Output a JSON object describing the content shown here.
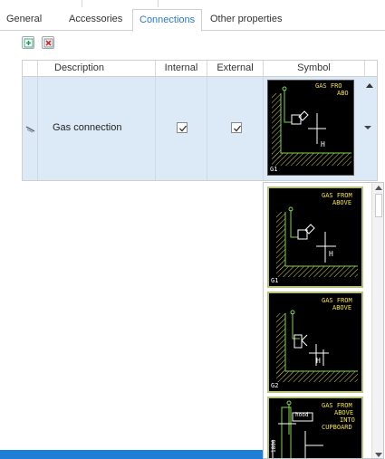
{
  "tabs": [
    {
      "label": "General",
      "active": false
    },
    {
      "label": "Accessories",
      "active": false
    },
    {
      "label": "Connections",
      "active": true
    },
    {
      "label": "Other properties",
      "active": false
    }
  ],
  "toolbar": {
    "add_icon": "add-row-icon",
    "remove_icon": "delete-row-icon"
  },
  "grid": {
    "columns": [
      "Description",
      "Internal",
      "External",
      "Symbol"
    ],
    "rows": [
      {
        "description": "Gas connection",
        "internal": true,
        "external": true,
        "symbol": "G1",
        "symbol_text": [
          "GAS FRO",
          "ABO"
        ],
        "symbol_h": "H"
      }
    ]
  },
  "symbol_options": [
    {
      "code": "G1",
      "lines": [
        "GAS FROM",
        "ABOVE"
      ],
      "h": "H"
    },
    {
      "code": "G2",
      "lines": [
        "GAS FROM",
        "ABOVE"
      ],
      "h": "H"
    },
    {
      "code": "",
      "lines": [
        "GAS FROM",
        "ABOVE",
        "INTO",
        "CUPBOARD"
      ],
      "hood": "hood",
      "dim": "1800"
    }
  ],
  "colors": {
    "accent": "#2b79c7",
    "selection": "#dce9f7",
    "cad_bg": "#000000",
    "cad_line": "#7fd34a",
    "cad_text": "#f0e040",
    "status_bar": "#1f7fd6"
  }
}
